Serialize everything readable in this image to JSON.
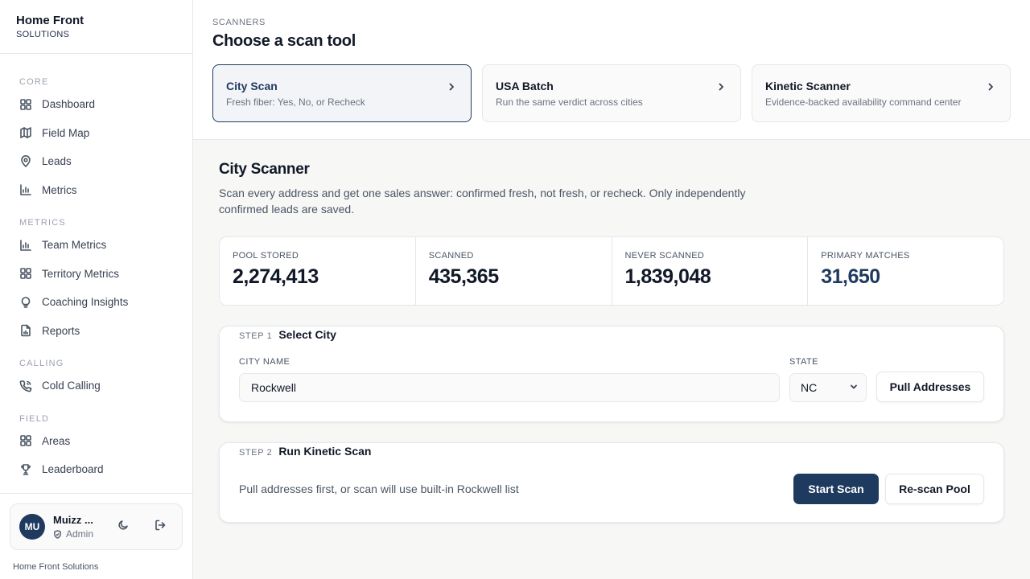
{
  "brand": {
    "title": "Home Front",
    "subtitle": "SOLUTIONS"
  },
  "nav": {
    "sections": [
      {
        "label": "CORE",
        "items": [
          {
            "label": "Dashboard",
            "icon": "grid-icon"
          },
          {
            "label": "Field Map",
            "icon": "map-icon"
          },
          {
            "label": "Leads",
            "icon": "map-pin-icon"
          },
          {
            "label": "Metrics",
            "icon": "bar-chart-icon"
          }
        ]
      },
      {
        "label": "METRICS",
        "items": [
          {
            "label": "Team Metrics",
            "icon": "bar-chart-icon"
          },
          {
            "label": "Territory Metrics",
            "icon": "grid-icon"
          },
          {
            "label": "Coaching Insights",
            "icon": "lightbulb-icon"
          },
          {
            "label": "Reports",
            "icon": "file-chart-icon"
          }
        ]
      },
      {
        "label": "CALLING",
        "items": [
          {
            "label": "Cold Calling",
            "icon": "phone-icon"
          }
        ]
      },
      {
        "label": "FIELD",
        "items": [
          {
            "label": "Areas",
            "icon": "grid-icon"
          },
          {
            "label": "Leaderboard",
            "icon": "trophy-icon"
          }
        ]
      }
    ]
  },
  "user": {
    "initials": "MU",
    "name": "Muizz ...",
    "role": "Admin"
  },
  "footer": {
    "text": "Home Front Solutions"
  },
  "header": {
    "eyebrow": "SCANNERS",
    "title": "Choose a scan tool"
  },
  "tools": [
    {
      "name": "City Scan",
      "desc": "Fresh fiber: Yes, No, or Recheck",
      "active": true
    },
    {
      "name": "USA Batch",
      "desc": "Run the same verdict across cities",
      "active": false
    },
    {
      "name": "Kinetic Scanner",
      "desc": "Evidence-backed availability command center",
      "active": false
    }
  ],
  "scanner": {
    "title": "City Scanner",
    "description": "Scan every address and get one sales answer: confirmed fresh, not fresh, or recheck. Only independently confirmed leads are saved."
  },
  "stats": [
    {
      "label": "POOL STORED",
      "value": "2,274,413"
    },
    {
      "label": "SCANNED",
      "value": "435,365"
    },
    {
      "label": "NEVER SCANNED",
      "value": "1,839,048"
    },
    {
      "label": "PRIMARY MATCHES",
      "value": "31,650"
    }
  ],
  "step1": {
    "num": "STEP 1",
    "name": "Select City",
    "city_label": "CITY NAME",
    "city_value": "Rockwell",
    "state_label": "STATE",
    "state_value": "NC",
    "pull_button": "Pull Addresses"
  },
  "step2": {
    "num": "STEP 2",
    "name": "Run Kinetic Scan",
    "hint": "Pull addresses first, or scan will use built-in Rockwell list",
    "start_button": "Start Scan",
    "rescan_button": "Re-scan Pool"
  },
  "colors": {
    "accent": "#1f3a5f",
    "border": "#e5e7eb",
    "background": "#f7f7f6"
  }
}
